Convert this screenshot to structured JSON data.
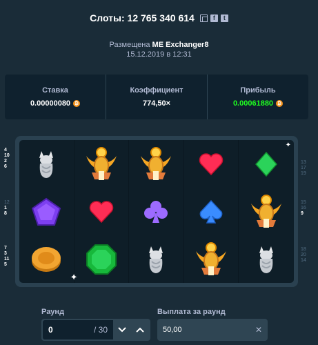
{
  "header": {
    "title": "Слоты: 12 765 340 614",
    "placed_prefix": "Размещена",
    "user_badge": "ME",
    "user_name": "Exchanger8",
    "datetime": "15.12.2019 в 12:31"
  },
  "stats": {
    "bet_label": "Ставка",
    "bet_value": "0.00000080",
    "multiplier_label": "Коэффициент",
    "multiplier_value": "774,50×",
    "profit_label": "Прибыль",
    "profit_value": "0.00061880",
    "coin_symbol": "₿",
    "profit_color": "#1fff20"
  },
  "board": {
    "symbols": [
      [
        "cat-statue",
        "scarab",
        "scarab",
        "heart",
        "diamond"
      ],
      [
        "gem-pentagon",
        "heart",
        "club",
        "spade",
        "scarab"
      ],
      [
        "coin",
        "emerald",
        "cat-statue",
        "scarab",
        "cat-statue"
      ]
    ]
  },
  "paylines": {
    "left_top": [
      "4",
      "10",
      "2",
      "6"
    ],
    "left_mid": [
      "12",
      "1",
      "8"
    ],
    "left_bot": [
      "7",
      "3",
      "11",
      "5"
    ],
    "right_top": [
      "13",
      "17",
      "19"
    ],
    "right_mid": [
      "15",
      "16",
      "9"
    ],
    "right_bot": [
      "18",
      "20",
      "14"
    ]
  },
  "controls": {
    "round_label": "Раунд",
    "round_value": "0",
    "round_total": "/ 30",
    "down_icon": "chevron-down-icon",
    "up_icon": "chevron-up-icon",
    "payout_label": "Выплата за раунд",
    "payout_value": "50,00",
    "clear_icon": "✕"
  }
}
